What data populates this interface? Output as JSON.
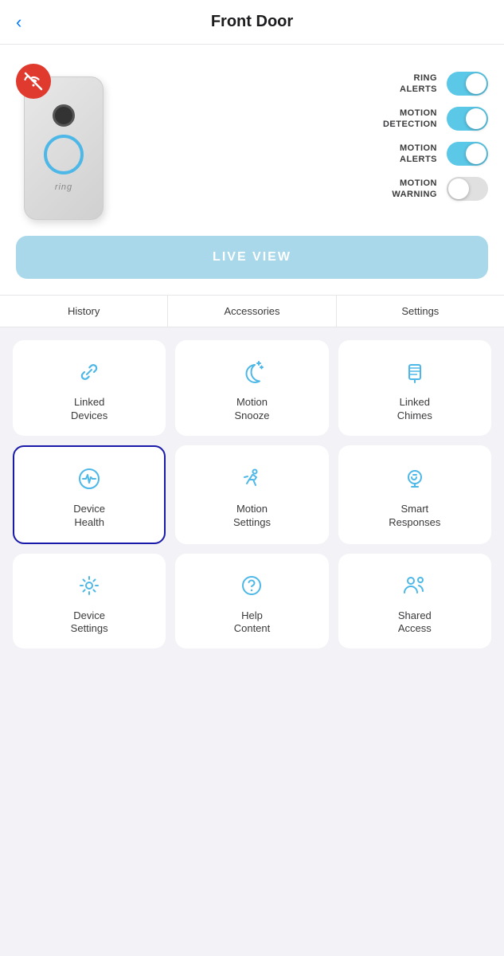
{
  "header": {
    "title": "Front Door",
    "back_label": "‹"
  },
  "toggles": [
    {
      "label": "RING\nALERTS",
      "state": "on"
    },
    {
      "label": "MOTION\nDETECTION",
      "state": "on"
    },
    {
      "label": "MOTION\nALERTS",
      "state": "on"
    },
    {
      "label": "MOTION\nWARNING",
      "state": "off"
    }
  ],
  "live_view": {
    "label": "LIVE VIEW"
  },
  "tabs": [
    {
      "label": "History"
    },
    {
      "label": "Accessories"
    },
    {
      "label": "Settings"
    }
  ],
  "grid_items": [
    {
      "id": "linked-devices",
      "label": "Linked\nDevices",
      "icon": "link"
    },
    {
      "id": "motion-snooze",
      "label": "Motion\nSnooze",
      "icon": "moon"
    },
    {
      "id": "linked-chimes",
      "label": "Linked\nChimes",
      "icon": "chimes"
    },
    {
      "id": "device-health",
      "label": "Device\nHealth",
      "icon": "heartbeat",
      "selected": true
    },
    {
      "id": "motion-settings",
      "label": "Motion\nSettings",
      "icon": "running"
    },
    {
      "id": "smart-responses",
      "label": "Smart\nResponses",
      "icon": "speech"
    },
    {
      "id": "device-settings",
      "label": "Device\nSettings",
      "icon": "gear"
    },
    {
      "id": "help-content",
      "label": "Help\nContent",
      "icon": "question"
    },
    {
      "id": "shared-access",
      "label": "Shared\nAccess",
      "icon": "people"
    }
  ],
  "colors": {
    "accent_blue": "#5bc8e8",
    "brand_blue": "#4db8e8",
    "nav_blue": "#007aff",
    "selected_border": "#1a1aaa",
    "wifi_red": "#e0392d",
    "icon_teal": "#4db8e8"
  }
}
